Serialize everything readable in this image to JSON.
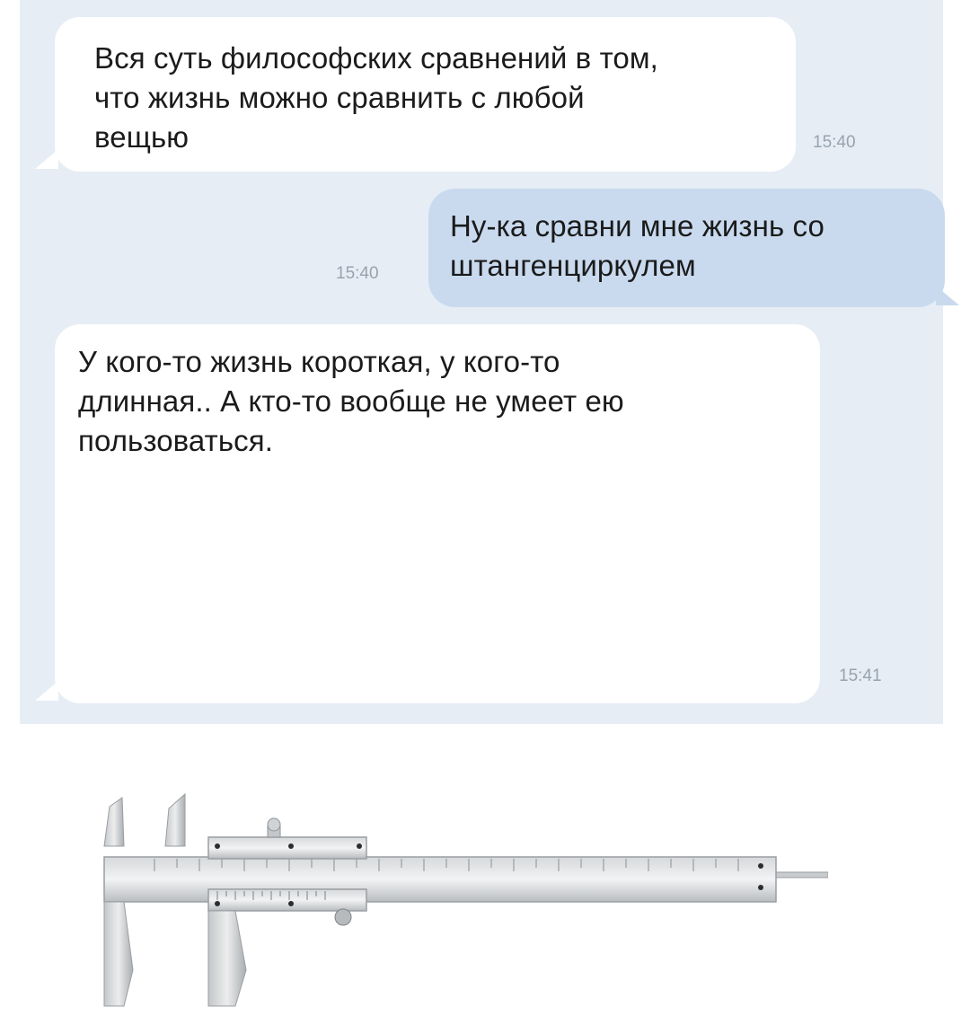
{
  "messages": [
    {
      "direction": "incoming",
      "text": "Вся суть философских сравнений в том,\nчто жизнь можно сравнить с любой\nвещью",
      "time": "15:40"
    },
    {
      "direction": "outgoing",
      "text": "Ну-ка сравни мне жизнь со\nштангенциркулем",
      "time": "15:40"
    },
    {
      "direction": "incoming",
      "text": "У кого-то жизнь короткая, у кого-то\nдлинная.. А кто-то вообще не умеет ею\nпользоваться.",
      "time": "15:41",
      "attachment": "caliper-image"
    }
  ],
  "colors": {
    "chat_background": "#e6edf5",
    "incoming_bubble": "#ffffff",
    "outgoing_bubble": "#c9daef",
    "time_text": "#98a3ae"
  }
}
